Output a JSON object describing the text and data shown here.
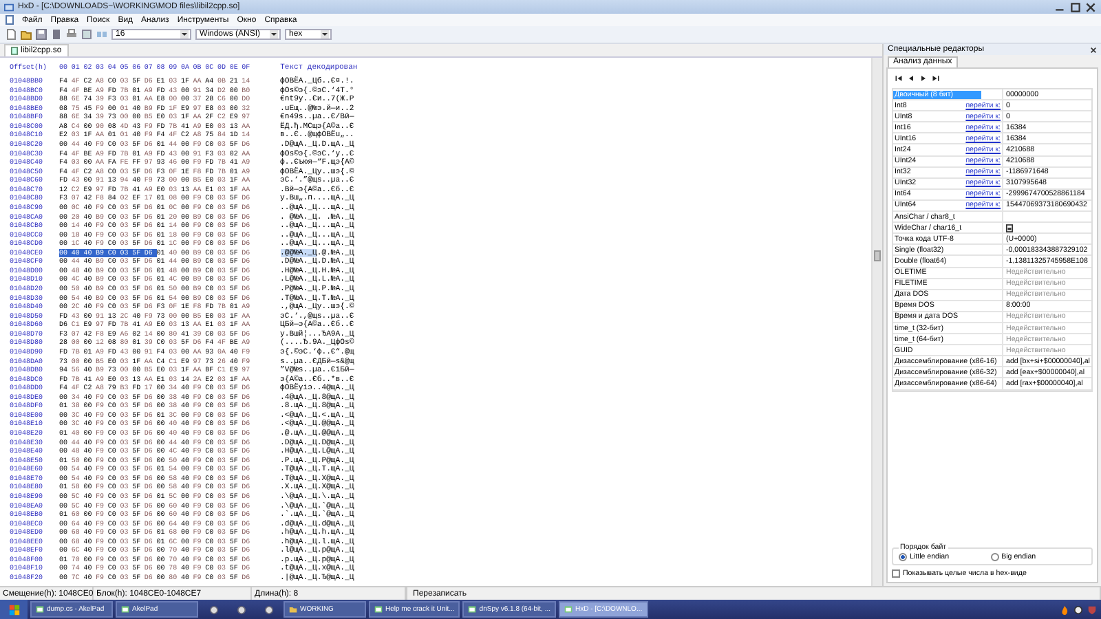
{
  "window": {
    "title": "HxD - [C:\\DOWNLOADS~\\WORKING\\MOD files\\libil2cpp.so]"
  },
  "menu": [
    "Файл",
    "Правка",
    "Поиск",
    "Вид",
    "Анализ",
    "Инструменты",
    "Окно",
    "Справка"
  ],
  "toolbar": {
    "bytes_per_row": "16",
    "charset": "Windows (ANSI)",
    "offset_base": "hex"
  },
  "tabs": [
    {
      "label": "libil2cpp.so",
      "selected": true
    }
  ],
  "editor": {
    "offset_header": "Offset(h)",
    "columns": "00 01 02 03 04 05 06 07 08 09 0A 0B 0C 0D 0E 0F",
    "text_header": "Текст декодирован",
    "rows": [
      {
        "offset": "01048BB0",
        "hex": [
          "F4 4F C2 A8 C0 03 5F D6",
          "E1 03 1F AA A4 0B 21 14"
        ],
        "text": [
          "фOВЁА._Ц",
          "б..Є¤.!."
        ],
        "selected": false
      },
      {
        "offset": "01048BC0",
        "hex": [
          "F4 4F BE A9 FD 7B 01 A9",
          "FD 43 00 91 34 D2 00 B0"
        ],
        "text": [
          "фOѕ©э{.©",
          "эC.‘4Т.°"
        ],
        "selected": false
      },
      {
        "offset": "01048BD0",
        "hex": [
          "88 6E 74 39 F3 03 01 AA",
          "E8 00 00 37 28 C6 00 D0"
        ],
        "text": [
          "€nt9у..Є",
          "и..7(Ж.Р"
        ],
        "selected": false
      },
      {
        "offset": "01048BE0",
        "hex": [
          "08 75 45 F9 00 01 40 B9",
          "FD 1F E9 97 E8 03 00 32"
        ],
        "text": [
          ".uEщ..@№",
          "э.й—и..2"
        ],
        "selected": false
      },
      {
        "offset": "01048BF0",
        "hex": [
          "88 6E 34 39 73 00 00 B5",
          "E0 03 1F AA 2F C2 E9 97"
        ],
        "text": [
          "€n49s..µ",
          "а..Є/Вй—"
        ],
        "selected": false
      },
      {
        "offset": "01048C00",
        "hex": [
          "A8 C4 00 90 08 4D 43 F9",
          "FD 7B 41 A9 E0 03 13 AA"
        ],
        "text": [
          "ЁД.ђ.MCщ",
          "э{A©а..Є"
        ],
        "selected": false
      },
      {
        "offset": "01048C10",
        "hex": [
          "E2 03 1F AA 01 01 40 F9",
          "F4 4F C2 A8 75 84 1D 14"
        ],
        "text": [
          "в..Є..@щ",
          "фOВЁu„.."
        ],
        "selected": false
      },
      {
        "offset": "01048C20",
        "hex": [
          "00 44 40 F9 C0 03 5F D6",
          "01 44 00 F9 C0 03 5F D6"
        ],
        "text": [
          ".D@щА._Ц",
          ".D.щА._Ц"
        ],
        "selected": false
      },
      {
        "offset": "01048C30",
        "hex": [
          "F4 4F BE A9 FD 7B 01 A9",
          "FD 43 00 91 F3 03 02 AA"
        ],
        "text": [
          "фOѕ©э{.©",
          "эC.‘у..Є"
        ],
        "selected": false
      },
      {
        "offset": "01048C40",
        "hex": [
          "F4 03 00 AA FA FE FF 97",
          "93 46 00 F9 FD 7B 41 A9"
        ],
        "text": [
          "ф..Єъюя—",
          "“F.щэ{A©"
        ],
        "selected": false
      },
      {
        "offset": "01048C50",
        "hex": [
          "F4 4F C2 A8 C0 03 5F D6",
          "F3 0F 1E F8 FD 7B 01 A9"
        ],
        "text": [
          "фOВЁА._Ц",
          "у..шэ{.©"
        ],
        "selected": false
      },
      {
        "offset": "01048C60",
        "hex": [
          "FD 43 00 91 13 94 40 F9",
          "73 00 00 B5 E0 03 1F AA"
        ],
        "text": [
          "эC.‘.”@щ",
          "s..µа..Є"
        ],
        "selected": false
      },
      {
        "offset": "01048C70",
        "hex": [
          "12 C2 E9 97 FD 7B 41 A9",
          "E0 03 13 AA E1 03 1F AA"
        ],
        "text": [
          ".Вй—э{A©",
          "а..Єб..Є"
        ],
        "selected": false
      },
      {
        "offset": "01048C80",
        "hex": [
          "F3 07 42 F8 84 02 EF 17",
          "01 08 00 F9 C0 03 5F D6"
        ],
        "text": [
          "у.Bш„.п.",
          "...щА._Ц"
        ],
        "selected": false
      },
      {
        "offset": "01048C90",
        "hex": [
          "00 0C 40 F9 C0 03 5F D6",
          "01 0C 00 F9 C0 03 5F D6"
        ],
        "text": [
          "..@щА._Ц",
          "...щА._Ц"
        ],
        "selected": false
      },
      {
        "offset": "01048CA0",
        "hex": [
          "00 20 40 B9 C0 03 5F D6",
          "01 20 00 B9 C0 03 5F D6"
        ],
        "text": [
          ". @№А._Ц",
          ". .№А._Ц"
        ],
        "selected": false
      },
      {
        "offset": "01048CB0",
        "hex": [
          "00 14 40 F9 C0 03 5F D6",
          "01 14 00 F9 C0 03 5F D6"
        ],
        "text": [
          "..@щА._Ц",
          "...щА._Ц"
        ],
        "selected": false
      },
      {
        "offset": "01048CC0",
        "hex": [
          "00 18 40 F9 C0 03 5F D6",
          "01 18 00 F9 C0 03 5F D6"
        ],
        "text": [
          "..@щА._Ц",
          "...щА._Ц"
        ],
        "selected": false
      },
      {
        "offset": "01048CD0",
        "hex": [
          "00 1C 40 F9 C0 03 5F D6",
          "01 1C 00 F9 C0 03 5F D6"
        ],
        "text": [
          "..@щА._Ц",
          "...щА._Ц"
        ],
        "selected": false
      },
      {
        "offset": "01048CE0",
        "hex": [
          "00 40 40 B9 C0 03 5F D6",
          "01 40 00 B9 C0 03 5F D6"
        ],
        "text": [
          ".@@№А._Ц",
          ".@.№А._Ц"
        ],
        "selected": true
      },
      {
        "offset": "01048CF0",
        "hex": [
          "00 44 40 B9 C0 03 5F D6",
          "01 44 00 B9 C0 03 5F D6"
        ],
        "text": [
          ".D@№А._Ц",
          ".D.№А._Ц"
        ],
        "selected": false
      },
      {
        "offset": "01048D00",
        "hex": [
          "00 48 40 B9 C0 03 5F D6",
          "01 48 00 B9 C0 03 5F D6"
        ],
        "text": [
          ".H@№А._Ц",
          ".H.№А._Ц"
        ],
        "selected": false
      },
      {
        "offset": "01048D10",
        "hex": [
          "00 4C 40 B9 C0 03 5F D6",
          "01 4C 00 B9 C0 03 5F D6"
        ],
        "text": [
          ".L@№А._Ц",
          ".L.№А._Ц"
        ],
        "selected": false
      },
      {
        "offset": "01048D20",
        "hex": [
          "00 50 40 B9 C0 03 5F D6",
          "01 50 00 B9 C0 03 5F D6"
        ],
        "text": [
          ".P@№А._Ц",
          ".P.№А._Ц"
        ],
        "selected": false
      },
      {
        "offset": "01048D30",
        "hex": [
          "00 54 40 B9 C0 03 5F D6",
          "01 54 00 B9 C0 03 5F D6"
        ],
        "text": [
          ".T@№А._Ц",
          ".T.№А._Ц"
        ],
        "selected": false
      },
      {
        "offset": "01048D40",
        "hex": [
          "00 2C 40 F9 C0 03 5F D6",
          "F3 0F 1E F8 FD 7B 01 A9"
        ],
        "text": [
          ".,@щА._Ц",
          "у..шэ{.©"
        ],
        "selected": false
      },
      {
        "offset": "01048D50",
        "hex": [
          "FD 43 00 91 13 2C 40 F9",
          "73 00 00 B5 E0 03 1F AA"
        ],
        "text": [
          "эC.‘.,@щ",
          "s..µа..Є"
        ],
        "selected": false
      },
      {
        "offset": "01048D60",
        "hex": [
          "D6 C1 E9 97 FD 7B 41 A9",
          "E0 03 13 AA E1 03 1F AA"
        ],
        "text": [
          "ЦБй—э{A©",
          "а..Єб..Є"
        ],
        "selected": false
      },
      {
        "offset": "01048D70",
        "hex": [
          "F3 07 42 F8 E9 A6 02 14",
          "00 80 41 39 C0 03 5F D6"
        ],
        "text": [
          "у.Bшй¦..",
          ".ЂA9А._Ц"
        ],
        "selected": false
      },
      {
        "offset": "01048D80",
        "hex": [
          "28 00 00 12 08 80 01 39",
          "C0 03 5F D6 F4 4F BE A9"
        ],
        "text": [
          "(....Ђ.9",
          "А._ЦфOѕ©"
        ],
        "selected": false
      },
      {
        "offset": "01048D90",
        "hex": [
          "FD 7B 01 A9 FD 43 00 91",
          "F4 03 00 AA 93 0A 40 F9"
        ],
        "text": [
          "э{.©эC.‘",
          "ф..Є“.@щ"
        ],
        "selected": false
      },
      {
        "offset": "01048DA0",
        "hex": [
          "73 00 00 B5 E0 03 1F AA",
          "C4 C1 E9 97 73 26 40 F9"
        ],
        "text": [
          "s..µа..Є",
          "ДБй—s&@щ"
        ],
        "selected": false
      },
      {
        "offset": "01048DB0",
        "hex": [
          "94 56 40 B9 73 00 00 B5",
          "E0 03 1F AA BF C1 E9 97"
        ],
        "text": [
          "”V@№s..µ",
          "а..ЄїБй—"
        ],
        "selected": false
      },
      {
        "offset": "01048DC0",
        "hex": [
          "FD 7B 41 A9 E0 03 13 AA",
          "E1 03 14 2A E2 03 1F AA"
        ],
        "text": [
          "э{A©а..Є",
          "б..*в..Є"
        ],
        "selected": false
      },
      {
        "offset": "01048DD0",
        "hex": [
          "F4 4F C2 A8 79 B3 FD 17",
          "00 34 40 F9 C0 03 5F D6"
        ],
        "text": [
          "фOВЁyіэ.",
          ".4@щА._Ц"
        ],
        "selected": false
      },
      {
        "offset": "01048DE0",
        "hex": [
          "00 34 40 F9 C0 03 5F D6",
          "00 38 40 F9 C0 03 5F D6"
        ],
        "text": [
          ".4@щА._Ц",
          ".8@щА._Ц"
        ],
        "selected": false
      },
      {
        "offset": "01048DF0",
        "hex": [
          "01 38 00 F9 C0 03 5F D6",
          "00 38 40 F9 C0 03 5F D6"
        ],
        "text": [
          ".8.щА._Ц",
          ".8@щА._Ц"
        ],
        "selected": false
      },
      {
        "offset": "01048E00",
        "hex": [
          "00 3C 40 F9 C0 03 5F D6",
          "01 3C 00 F9 C0 03 5F D6"
        ],
        "text": [
          ".<@щА._Ц",
          ".<.щА._Ц"
        ],
        "selected": false
      },
      {
        "offset": "01048E10",
        "hex": [
          "00 3C 40 F9 C0 03 5F D6",
          "00 40 40 F9 C0 03 5F D6"
        ],
        "text": [
          ".<@щА._Ц",
          ".@@щА._Ц"
        ],
        "selected": false
      },
      {
        "offset": "01048E20",
        "hex": [
          "01 40 00 F9 C0 03 5F D6",
          "00 40 40 F9 C0 03 5F D6"
        ],
        "text": [
          ".@.щА._Ц",
          ".@@щА._Ц"
        ],
        "selected": false
      },
      {
        "offset": "01048E30",
        "hex": [
          "00 44 40 F9 C0 03 5F D6",
          "00 44 40 F9 C0 03 5F D6"
        ],
        "text": [
          ".D@щА._Ц",
          ".D@щА._Ц"
        ],
        "selected": false
      },
      {
        "offset": "01048E40",
        "hex": [
          "00 48 40 F9 C0 03 5F D6",
          "00 4C 40 F9 C0 03 5F D6"
        ],
        "text": [
          ".H@щА._Ц",
          ".L@щА._Ц"
        ],
        "selected": false
      },
      {
        "offset": "01048E50",
        "hex": [
          "01 50 00 F9 C0 03 5F D6",
          "00 50 40 F9 C0 03 5F D6"
        ],
        "text": [
          ".P.щА._Ц",
          ".P@щА._Ц"
        ],
        "selected": false
      },
      {
        "offset": "01048E60",
        "hex": [
          "00 54 40 F9 C0 03 5F D6",
          "01 54 00 F9 C0 03 5F D6"
        ],
        "text": [
          ".T@щА._Ц",
          ".T.щА._Ц"
        ],
        "selected": false
      },
      {
        "offset": "01048E70",
        "hex": [
          "00 54 40 F9 C0 03 5F D6",
          "00 58 40 F9 C0 03 5F D6"
        ],
        "text": [
          ".T@щА._Ц",
          ".X@щА._Ц"
        ],
        "selected": false
      },
      {
        "offset": "01048E80",
        "hex": [
          "01 58 00 F9 C0 03 5F D6",
          "00 58 40 F9 C0 03 5F D6"
        ],
        "text": [
          ".X.щА._Ц",
          ".X@щА._Ц"
        ],
        "selected": false
      },
      {
        "offset": "01048E90",
        "hex": [
          "00 5C 40 F9 C0 03 5F D6",
          "01 5C 00 F9 C0 03 5F D6"
        ],
        "text": [
          ".\\@щА._Ц",
          ".\\.щА._Ц"
        ],
        "selected": false
      },
      {
        "offset": "01048EA0",
        "hex": [
          "00 5C 40 F9 C0 03 5F D6",
          "00 60 40 F9 C0 03 5F D6"
        ],
        "text": [
          ".\\@щА._Ц",
          ".`@щА._Ц"
        ],
        "selected": false
      },
      {
        "offset": "01048EB0",
        "hex": [
          "01 60 00 F9 C0 03 5F D6",
          "00 60 40 F9 C0 03 5F D6"
        ],
        "text": [
          ".`.щА._Ц",
          ".`@щА._Ц"
        ],
        "selected": false
      },
      {
        "offset": "01048EC0",
        "hex": [
          "00 64 40 F9 C0 03 5F D6",
          "00 64 40 F9 C0 03 5F D6"
        ],
        "text": [
          ".d@щА._Ц",
          ".d@щА._Ц"
        ],
        "selected": false
      },
      {
        "offset": "01048ED0",
        "hex": [
          "00 68 40 F9 C0 03 5F D6",
          "01 68 00 F9 C0 03 5F D6"
        ],
        "text": [
          ".h@щА._Ц",
          ".h.щА._Ц"
        ],
        "selected": false
      },
      {
        "offset": "01048EE0",
        "hex": [
          "00 68 40 F9 C0 03 5F D6",
          "01 6C 00 F9 C0 03 5F D6"
        ],
        "text": [
          ".h@щА._Ц",
          ".l.щА._Ц"
        ],
        "selected": false
      },
      {
        "offset": "01048EF0",
        "hex": [
          "00 6C 40 F9 C0 03 5F D6",
          "00 70 40 F9 C0 03 5F D6"
        ],
        "text": [
          ".l@щА._Ц",
          ".p@щА._Ц"
        ],
        "selected": false
      },
      {
        "offset": "01048F00",
        "hex": [
          "01 70 00 F9 C0 03 5F D6",
          "00 70 40 F9 C0 03 5F D6"
        ],
        "text": [
          ".p.щА._Ц",
          ".p@щА._Ц"
        ],
        "selected": false
      },
      {
        "offset": "01048F10",
        "hex": [
          "00 74 40 F9 C0 03 5F D6",
          "00 78 40 F9 C0 03 5F D6"
        ],
        "text": [
          ".t@щА._Ц",
          ".x@щА._Ц"
        ],
        "selected": false
      },
      {
        "offset": "01048F20",
        "hex": [
          "00 7C 40 F9 C0 03 5F D6",
          "00 80 40 F9 C0 03 5F D6"
        ],
        "text": [
          ".|@щА._Ц",
          ".Ђ@щА._Ц"
        ],
        "selected": false
      }
    ]
  },
  "side_panel": {
    "title": "Специальные редакторы",
    "tab": "Анализ данных",
    "fields": [
      {
        "label": "Двоичный (8 бит)",
        "value": "00000000",
        "selected": true,
        "invalid": false
      },
      {
        "label": "Int8",
        "goto": "перейти к:",
        "value": "0",
        "selected": false,
        "invalid": false
      },
      {
        "label": "UInt8",
        "goto": "перейти к:",
        "value": "0",
        "selected": false,
        "invalid": false
      },
      {
        "label": "Int16",
        "goto": "перейти к:",
        "value": "16384",
        "selected": false,
        "invalid": false
      },
      {
        "label": "UInt16",
        "goto": "перейти к:",
        "value": "16384",
        "selected": false,
        "invalid": false
      },
      {
        "label": "Int24",
        "goto": "перейти к:",
        "value": "4210688",
        "selected": false,
        "invalid": false
      },
      {
        "label": "UInt24",
        "goto": "перейти к:",
        "value": "4210688",
        "selected": false,
        "invalid": false
      },
      {
        "label": "Int32",
        "goto": "перейти к:",
        "value": "-1186971648",
        "selected": false,
        "invalid": false
      },
      {
        "label": "UInt32",
        "goto": "перейти к:",
        "value": "3107995648",
        "selected": false,
        "invalid": false
      },
      {
        "label": "Int64",
        "goto": "перейти к:",
        "value": "-2999674700528861184",
        "selected": false,
        "invalid": false
      },
      {
        "label": "UInt64",
        "goto": "перейти к:",
        "value": "15447069373180690432",
        "selected": false,
        "invalid": false
      },
      {
        "label": "AnsiChar / char8_t",
        "selected": false
      },
      {
        "label": "WideChar / char16_t",
        "kind": "glyph",
        "selected": false
      },
      {
        "label": "Точка кода UTF-8",
        "value": "(U+0000)",
        "selected": false,
        "invalid": false
      },
      {
        "label": "Single (float32)",
        "value": "-0,000183343887329102",
        "selected": false,
        "invalid": false
      },
      {
        "label": "Double (float64)",
        "value": "-1,13811325745958E108",
        "selected": false,
        "invalid": false
      },
      {
        "label": "OLETIME",
        "value": "Недействительно",
        "selected": false,
        "invalid": true
      },
      {
        "label": "FILETIME",
        "value": "Недействительно",
        "selected": false,
        "invalid": true
      },
      {
        "label": "Дата DOS",
        "value": "Недействительно",
        "selected": false,
        "invalid": true
      },
      {
        "label": "Время DOS",
        "value": "8:00:00",
        "selected": false,
        "invalid": false
      },
      {
        "label": "Время и дата DOS",
        "value": "Недействительно",
        "selected": false,
        "invalid": true
      },
      {
        "label": "time_t (32-бит)",
        "value": "Недействительно",
        "selected": false,
        "invalid": true
      },
      {
        "label": "time_t (64-бит)",
        "value": "Недействительно",
        "selected": false,
        "invalid": true
      },
      {
        "label": "GUID",
        "value": "Недействительно",
        "selected": false,
        "invalid": true
      },
      {
        "label": "Дизассемблирование (x86-16)",
        "value": "add [bx+si+$00000040],al",
        "selected": false,
        "invalid": false
      },
      {
        "label": "Дизассемблирование (x86-32)",
        "value": "add [eax+$00000040],al",
        "selected": false,
        "invalid": false
      },
      {
        "label": "Дизассемблирование (x86-64)",
        "value": "add [rax+$00000040],al",
        "selected": false,
        "invalid": false
      }
    ],
    "byte_order": {
      "title": "Порядок байт",
      "options": [
        {
          "label": "Little endian",
          "selected": true
        },
        {
          "label": "Big endian",
          "selected": false
        }
      ]
    },
    "hex_integers": {
      "label": "Показывать целые числа в hex-виде",
      "checked": false
    }
  },
  "status_bar": [
    "Смещение(h): 1048CE0",
    "Блок(h): 1048CE0-1048CE7",
    "Длина(h): 8",
    "Перезаписать"
  ],
  "taskbar": [
    {
      "kind": "app",
      "label": "dump.cs - AkelPad",
      "active": false
    },
    {
      "kind": "app",
      "label": "AkelPad",
      "active": false
    },
    {
      "kind": "icon"
    },
    {
      "kind": "icon"
    },
    {
      "kind": "icon"
    },
    {
      "kind": "folder",
      "label": "WORKING",
      "active": false
    },
    {
      "kind": "app",
      "label": "Help me crack it Unit...",
      "active": false
    },
    {
      "kind": "app",
      "label": "dnSpy v6.1.8 (64-bit, ...",
      "active": false
    },
    {
      "kind": "app",
      "label": "HxD - [C:\\DOWNLO...",
      "active": true
    }
  ]
}
